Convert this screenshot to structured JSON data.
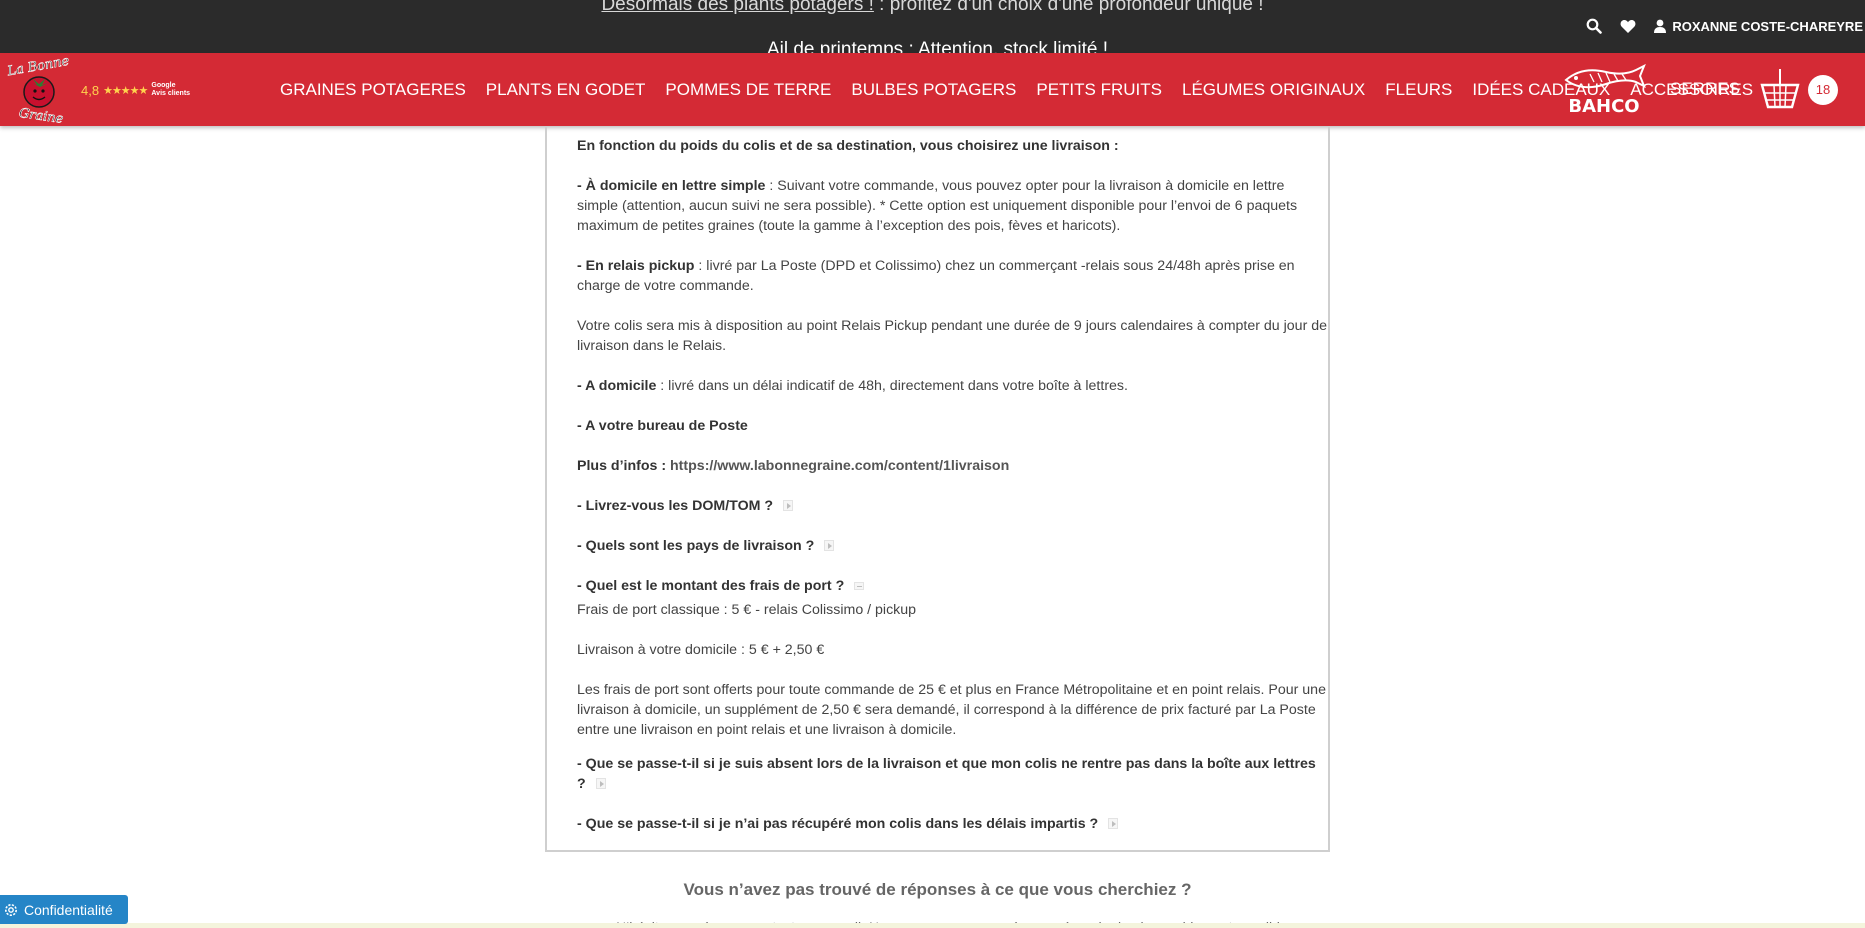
{
  "announcement": {
    "link_text": "Désormais des plants potagers !",
    "rest_text": " : profitez d'un choix d'une profondeur unique !",
    "secondary": "Ail de printemps : Attention, stock limité !"
  },
  "utilities": {
    "search_icon": "search-icon",
    "wishlist_icon": "heart-icon",
    "user_icon": "user-icon",
    "user_name": "ROXANNE COSTE-CHAREYRE"
  },
  "brand": {
    "logo_line1": "La Bonne",
    "logo_line2": "Graine",
    "rating_score": "4,8",
    "rating_stars": "★★★★★",
    "rating_source_line1": "Google",
    "rating_source_line2": "Avis clients"
  },
  "nav": {
    "items": [
      {
        "label": "GRAINES POTAGERES"
      },
      {
        "label": "PLANTS EN GODET"
      },
      {
        "label": "POMMES DE TERRE"
      },
      {
        "label": "BULBES POTAGERS"
      },
      {
        "label": "PETITS FRUITS"
      },
      {
        "label": "LÉGUMES ORIGINAUX"
      },
      {
        "label": "FLEURS"
      },
      {
        "label": "IDÉES CADEAUX"
      },
      {
        "label": "ACCESSOIRES"
      }
    ],
    "partner_logo": "BAHCO",
    "serres": "SERRES",
    "cart_count": "18"
  },
  "colors": {
    "brand_red": "#d42a35",
    "topbar": "#2b2b2b",
    "privacy_blue": "#2585c7"
  },
  "faq": {
    "intro": "En fonction du poids du colis et de sa destination, vous choisirez une livraison :",
    "opt1_title": "- À domicile en lettre simple",
    "opt1_text": " : Suivant votre commande, vous pouvez opter pour la livraison à domicile en lettre simple (attention, aucun suivi ne sera possible). * Cette option est uniquement disponible pour l’envoi de 6 paquets maximum de petites graines (toute la gamme à l’exception des pois, fèves et haricots).",
    "opt2_title": "- En relais pickup",
    "opt2_text": " : livré par La Poste (DPD et Colissimo) chez un commerçant -relais sous 24/48h après prise en charge de votre commande.",
    "relay_note": "Votre colis sera mis à disposition au point Relais Pickup pendant une durée de 9 jours calendaires à compter du jour de livraison dans le Relais.",
    "opt3_title": "- A domicile",
    "opt3_text": " : livré dans un délai indicatif de 48h, directement dans votre boîte à lettres.",
    "opt4_title": "- A votre bureau de Poste",
    "more_label": "Plus d’infos : ",
    "more_link": "https://www.labonnegraine.com/content/1livraison",
    "q_domtom": "- Livrez-vous les DOM/TOM ?",
    "q_pays": "- Quels sont les pays de livraison ?",
    "q_frais": "- Quel est le montant des frais de port ?",
    "frais_1": "Frais de port classique : 5 € - relais Colissimo / pickup",
    "frais_2": "Livraison à votre domicile : 5 € + 2,50 €",
    "frais_3": "Les frais de port sont offerts pour toute commande de 25 € et plus en France Métropolitaine et en point relais. Pour une livraison à domicile, un supplément de 2,50 € sera demandé, il correspond à la différence de prix facturé par La Poste entre une livraison en point relais et une livraison à domicile.",
    "q_absent": "- Que se passe-t-il si je suis absent lors de la livraison et que mon colis ne rentre pas dans la boîte aux lettres ?",
    "q_delais": "- Que se passe-t-il si je n’ai pas récupéré mon colis dans les délais impartis ?"
  },
  "footer": {
    "not_found": "Vous n’avez pas trouvé de réponses à ce que vous cherchiez ?",
    "cut_line": "N’hésitez pas à nous contacter par mail. Nous nous engageons à vous répondre le plus rapidement possible.",
    "privacy_label": "Confidentialité",
    "privacy_icon": "gear-icon"
  }
}
